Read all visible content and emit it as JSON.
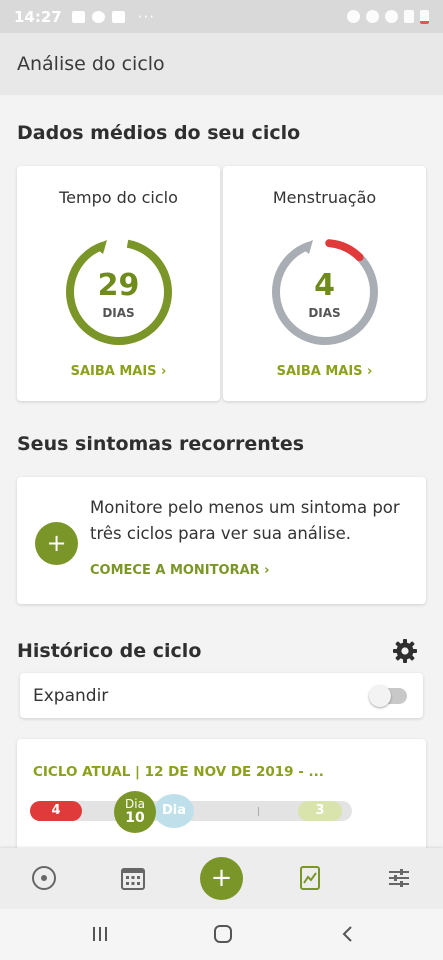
{
  "status_bar": {
    "time": "14:27",
    "dots": "···"
  },
  "app_bar": {
    "title": "Análise do ciclo"
  },
  "averages": {
    "title": "Dados médios do seu ciclo",
    "cycle": {
      "label": "Tempo do ciclo",
      "value": "29",
      "unit": "DIAS",
      "link": "SAIBA MAIS ›"
    },
    "period": {
      "label": "Menstruação",
      "value": "4",
      "unit": "DIAS",
      "link": "SAIBA MAIS ›"
    }
  },
  "symptoms": {
    "title": "Seus sintomas recorrentes",
    "message": "Monitore pelo menos um sintoma por três ciclos para ver sua análise.",
    "link": "COMECE A MONITORAR ›",
    "add_label": "+"
  },
  "history": {
    "title": "Histórico de ciclo",
    "expand_label": "Expandir",
    "expand_on": false,
    "current_cycle": "CICLO ATUAL | 12 DE NOV DE 2019 - ...",
    "period_days": "4",
    "current_day_label": "Dia",
    "current_day": "10",
    "ovulation_label": "Dia 16",
    "fertile_days": "3"
  },
  "bottom_nav": {
    "fab_label": "+"
  },
  "colors": {
    "accent": "#7b9628",
    "period": "#e03a3a",
    "ring_gray": "#a9aeb5"
  }
}
